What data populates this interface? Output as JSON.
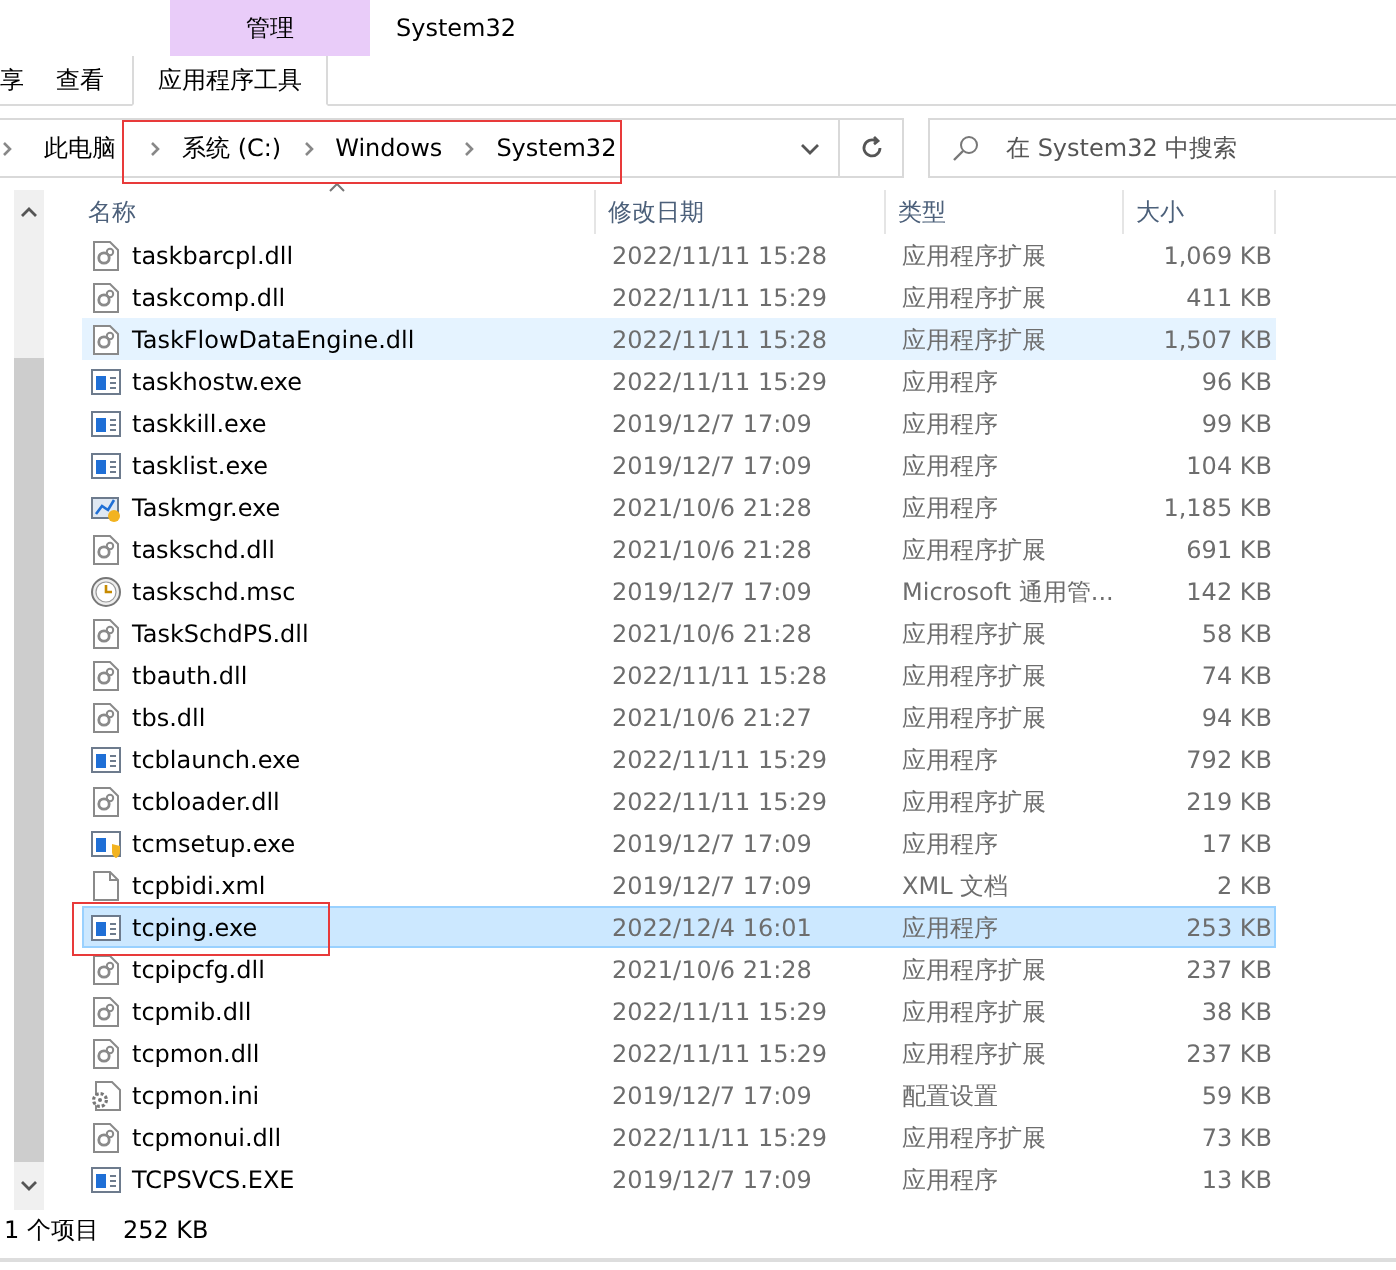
{
  "ribbon": {
    "context_tab": {
      "label": "管理"
    },
    "window_title": "System32",
    "tabs": [
      {
        "label": "享",
        "selected": false
      },
      {
        "label": "查看",
        "selected": false
      },
      {
        "label": "应用程序工具",
        "selected": true
      }
    ]
  },
  "address_bar": {
    "root": "此电脑",
    "crumbs": [
      "系统 (C:)",
      "Windows",
      "System32"
    ],
    "annotated": true
  },
  "search": {
    "placeholder": "在 System32 中搜索"
  },
  "table": {
    "columns": [
      "名称",
      "修改日期",
      "类型",
      "大小"
    ],
    "rows": [
      {
        "kind": "dll",
        "name": "taskbarcpl.dll",
        "date": "2022/11/11 15:28",
        "type": "应用程序扩展",
        "size": "1,069 KB",
        "selected": false,
        "hovered": false,
        "annotated": false
      },
      {
        "kind": "dll",
        "name": "taskcomp.dll",
        "date": "2022/11/11 15:29",
        "type": "应用程序扩展",
        "size": "411 KB",
        "selected": false,
        "hovered": false,
        "annotated": false
      },
      {
        "kind": "dll",
        "name": "TaskFlowDataEngine.dll",
        "date": "2022/11/11 15:28",
        "type": "应用程序扩展",
        "size": "1,507 KB",
        "selected": false,
        "hovered": true,
        "annotated": false
      },
      {
        "kind": "exe",
        "name": "taskhostw.exe",
        "date": "2022/11/11 15:29",
        "type": "应用程序",
        "size": "96 KB",
        "selected": false,
        "hovered": false,
        "annotated": false
      },
      {
        "kind": "exe",
        "name": "taskkill.exe",
        "date": "2019/12/7 17:09",
        "type": "应用程序",
        "size": "99 KB",
        "selected": false,
        "hovered": false,
        "annotated": false
      },
      {
        "kind": "exe",
        "name": "tasklist.exe",
        "date": "2019/12/7 17:09",
        "type": "应用程序",
        "size": "104 KB",
        "selected": false,
        "hovered": false,
        "annotated": false
      },
      {
        "kind": "monitor",
        "name": "Taskmgr.exe",
        "date": "2021/10/6 21:28",
        "type": "应用程序",
        "size": "1,185 KB",
        "selected": false,
        "hovered": false,
        "annotated": false
      },
      {
        "kind": "dll",
        "name": "taskschd.dll",
        "date": "2021/10/6 21:28",
        "type": "应用程序扩展",
        "size": "691 KB",
        "selected": false,
        "hovered": false,
        "annotated": false
      },
      {
        "kind": "clock",
        "name": "taskschd.msc",
        "date": "2019/12/7 17:09",
        "type": "Microsoft 通用管...",
        "size": "142 KB",
        "selected": false,
        "hovered": false,
        "annotated": false
      },
      {
        "kind": "dll",
        "name": "TaskSchdPS.dll",
        "date": "2021/10/6 21:28",
        "type": "应用程序扩展",
        "size": "58 KB",
        "selected": false,
        "hovered": false,
        "annotated": false
      },
      {
        "kind": "dll",
        "name": "tbauth.dll",
        "date": "2022/11/11 15:28",
        "type": "应用程序扩展",
        "size": "74 KB",
        "selected": false,
        "hovered": false,
        "annotated": false
      },
      {
        "kind": "dll",
        "name": "tbs.dll",
        "date": "2021/10/6 21:27",
        "type": "应用程序扩展",
        "size": "94 KB",
        "selected": false,
        "hovered": false,
        "annotated": false
      },
      {
        "kind": "exe",
        "name": "tcblaunch.exe",
        "date": "2022/11/11 15:29",
        "type": "应用程序",
        "size": "792 KB",
        "selected": false,
        "hovered": false,
        "annotated": false
      },
      {
        "kind": "dll",
        "name": "tcbloader.dll",
        "date": "2022/11/11 15:29",
        "type": "应用程序扩展",
        "size": "219 KB",
        "selected": false,
        "hovered": false,
        "annotated": false
      },
      {
        "kind": "shield",
        "name": "tcmsetup.exe",
        "date": "2019/12/7 17:09",
        "type": "应用程序",
        "size": "17 KB",
        "selected": false,
        "hovered": false,
        "annotated": false
      },
      {
        "kind": "blank",
        "name": "tcpbidi.xml",
        "date": "2019/12/7 17:09",
        "type": "XML 文档",
        "size": "2 KB",
        "selected": false,
        "hovered": false,
        "annotated": false
      },
      {
        "kind": "exe",
        "name": "tcping.exe",
        "date": "2022/12/4 16:01",
        "type": "应用程序",
        "size": "253 KB",
        "selected": true,
        "hovered": false,
        "annotated": true
      },
      {
        "kind": "dll",
        "name": "tcpipcfg.dll",
        "date": "2021/10/6 21:28",
        "type": "应用程序扩展",
        "size": "237 KB",
        "selected": false,
        "hovered": false,
        "annotated": false
      },
      {
        "kind": "dll",
        "name": "tcpmib.dll",
        "date": "2022/11/11 15:29",
        "type": "应用程序扩展",
        "size": "38 KB",
        "selected": false,
        "hovered": false,
        "annotated": false
      },
      {
        "kind": "dll",
        "name": "tcpmon.dll",
        "date": "2022/11/11 15:29",
        "type": "应用程序扩展",
        "size": "237 KB",
        "selected": false,
        "hovered": false,
        "annotated": false
      },
      {
        "kind": "gear",
        "name": "tcpmon.ini",
        "date": "2019/12/7 17:09",
        "type": "配置设置",
        "size": "59 KB",
        "selected": false,
        "hovered": false,
        "annotated": false
      },
      {
        "kind": "dll",
        "name": "tcpmonui.dll",
        "date": "2022/11/11 15:29",
        "type": "应用程序扩展",
        "size": "73 KB",
        "selected": false,
        "hovered": false,
        "annotated": false
      },
      {
        "kind": "exe",
        "name": "TCPSVCS.EXE",
        "date": "2019/12/7 17:09",
        "type": "应用程序",
        "size": "13 KB",
        "selected": false,
        "hovered": false,
        "annotated": false
      }
    ]
  },
  "status_bar": {
    "count": "1 个项目",
    "size": "252 KB"
  }
}
